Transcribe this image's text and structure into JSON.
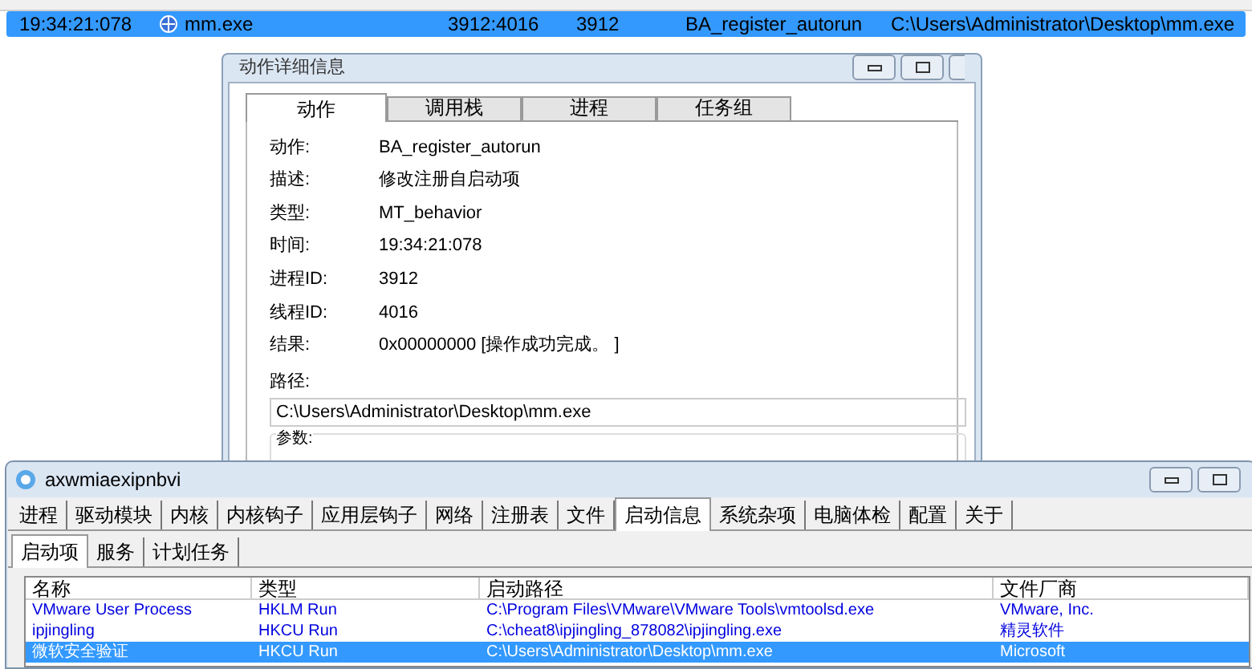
{
  "event_list": {
    "rows": [
      {
        "selected": true,
        "cells": [
          "19:34:21:078",
          "mm.exe",
          "3912:4016",
          "3912",
          "BA_register_autorun",
          "C:\\Users\\Administrator\\Desktop\\mm.exe"
        ]
      }
    ]
  },
  "detail_dialog": {
    "title": "动作详细信息",
    "tabs": [
      {
        "label": "动作",
        "selected": true
      },
      {
        "label": "调用栈",
        "selected": false
      },
      {
        "label": "进程",
        "selected": false
      },
      {
        "label": "任务组",
        "selected": false
      }
    ],
    "fields": [
      {
        "label": "动作:",
        "value": "BA_register_autorun"
      },
      {
        "label": "描述:",
        "value": "修改注册自启动项"
      },
      {
        "label": "类型:",
        "value": "MT_behavior"
      },
      {
        "label": "时间:",
        "value": "19:34:21:078"
      },
      {
        "label": "进程ID:",
        "value": "3912"
      },
      {
        "label": "线程ID:",
        "value": "4016"
      },
      {
        "label": "结果:",
        "value": "0x00000000 [操作成功完成。 ]"
      }
    ],
    "path_label": "路径:",
    "path_value": "C:\\Users\\Administrator\\Desktop\\mm.exe",
    "params_label": "参数:"
  },
  "main_window": {
    "title": "axwmiaexipnbvi",
    "tabs": [
      {
        "label": "进程",
        "selected": false
      },
      {
        "label": "驱动模块",
        "selected": false
      },
      {
        "label": "内核",
        "selected": false
      },
      {
        "label": "内核钩子",
        "selected": false
      },
      {
        "label": "应用层钩子",
        "selected": false
      },
      {
        "label": "网络",
        "selected": false
      },
      {
        "label": "注册表",
        "selected": false
      },
      {
        "label": "文件",
        "selected": false
      },
      {
        "label": "启动信息",
        "selected": true
      },
      {
        "label": "系统杂项",
        "selected": false
      },
      {
        "label": "电脑体检",
        "selected": false
      },
      {
        "label": "配置",
        "selected": false
      },
      {
        "label": "关于",
        "selected": false
      }
    ],
    "sub_tabs": [
      {
        "label": "启动项",
        "selected": true
      },
      {
        "label": "服务",
        "selected": false
      },
      {
        "label": "计划任务",
        "selected": false
      }
    ],
    "table": {
      "columns": [
        "名称",
        "类型",
        "启动路径",
        "文件厂商"
      ],
      "rows": [
        {
          "selected": false,
          "cells": [
            "VMware User Process",
            "HKLM Run",
            "C:\\Program Files\\VMware\\VMware Tools\\vmtoolsd.exe",
            "VMware, Inc."
          ]
        },
        {
          "selected": false,
          "cells": [
            "ipjingling",
            "HKCU Run",
            "C:\\cheat8\\ipjingling_878082\\ipjingling.exe",
            "精灵软件"
          ]
        },
        {
          "selected": true,
          "cells": [
            "微软安全验证",
            "HKCU Run",
            "C:\\Users\\Administrator\\Desktop\\mm.exe",
            "Microsoft"
          ]
        }
      ]
    }
  }
}
